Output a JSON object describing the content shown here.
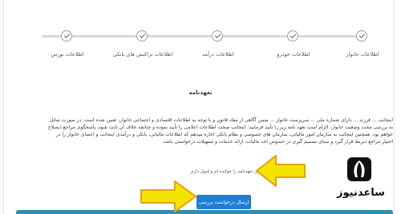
{
  "stepper": {
    "steps": [
      {
        "label": "اطلاعات بورس"
      },
      {
        "label": "اطلاعات تراکنش های بانکی"
      },
      {
        "label": "اطلاعات درآمد"
      },
      {
        "label": "اطلاعات خودرو"
      },
      {
        "label": "اطلاعات خانوار"
      }
    ]
  },
  "main": {
    "title": "تعهدنامه",
    "paragraph": "اینجانب ... فرزند ... دارای شماره ملی ... سرپرست خانوار ... ضمن آگاهی از مفاد قانون و با توجه به اطلاعات اقتصادی و اجتماعی خانوار، تعیین شده است. در صورت تمایل به بررسی مجدد وضعیت خانوار، الزام است تعهد نامه زیر را تأیید فرمایید: اینجانب صحت اطلاعات اعلامی را تأیید نموده و چنانچه خلاف آن ثابت شود، پاسخگوی مراجع ذیصلاح خواهم بود. همچنین اینجانب به سازمان امور مالیاتی، سازمان های خصوصی و نظام بانکی اجازه میدهم که اطلاعات مالیاتی، بانکی و درآمدی اینجانب و اعضای خانوار را در اختیار مراجع ذیربط قرار گیرد و مبنای تصمیم گیری در خصوص اخذ مالیات، ارائه خدمات و تسهیلات درخواستی باشد.",
    "checkbox_label": "متن تعهدنامه را خوانده ام و قبول دارم",
    "checkbox_checked": true,
    "submit_label": "ارسال درخواست بررسی"
  },
  "watermark": {
    "text": "ساعدنیوز"
  },
  "colors": {
    "accent": "#1e7fd6",
    "checkbox": "#2d6cc9",
    "arrow_fill": "#f5e400",
    "arrow_stroke": "#e6a100"
  },
  "icons": {
    "step_icon": "check-circle-icon",
    "arrow": "yellow-arrow-icon",
    "logo": "feather-logo-icon"
  }
}
